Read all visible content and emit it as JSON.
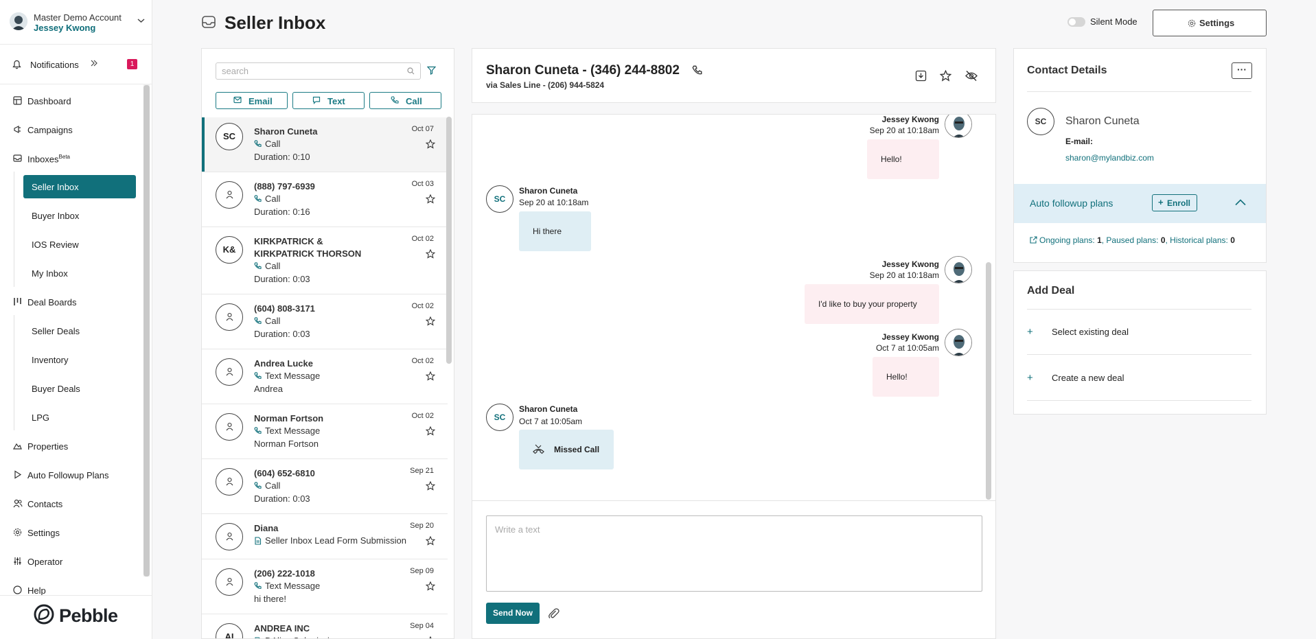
{
  "account": {
    "line1": "Master Demo Account",
    "line2": "Jessey Kwong"
  },
  "notifications": {
    "label": "Notifications",
    "count": "1"
  },
  "nav": {
    "dashboard": "Dashboard",
    "campaigns": "Campaigns",
    "inboxes": "Inboxes",
    "inboxes_sup": "Beta",
    "seller_inbox": "Seller Inbox",
    "buyer_inbox": "Buyer Inbox",
    "ios_review": "IOS Review",
    "my_inbox": "My Inbox",
    "deal_boards": "Deal Boards",
    "seller_deals": "Seller Deals",
    "inventory": "Inventory",
    "buyer_deals": "Buyer Deals",
    "lpg": "LPG",
    "properties": "Properties",
    "auto_followup": "Auto Followup Plans",
    "contacts": "Contacts",
    "settings": "Settings",
    "operator": "Operator",
    "help": "Help"
  },
  "brand": {
    "logo_text": "Pebble"
  },
  "header": {
    "title": "Seller Inbox",
    "silent_mode": "Silent Mode",
    "silent_mode_on": false,
    "settings_label": "Settings"
  },
  "list": {
    "search_placeholder": "search",
    "buttons": {
      "email": "Email",
      "text": "Text",
      "call": "Call"
    },
    "conversations": [
      {
        "initials": "SC",
        "name": "Sharon Cuneta",
        "type": "Call",
        "sub": "Duration: 0:10",
        "date": "Oct 07"
      },
      {
        "initials": "",
        "name": "(888) 797-6939",
        "type": "Call",
        "sub": "Duration: 0:16",
        "date": "Oct 03"
      },
      {
        "initials": "K&",
        "name": "KIRKPATRICK & KIRKPATRICK THORSON",
        "type": "Call",
        "sub": "Duration: 0:03",
        "date": "Oct 02"
      },
      {
        "initials": "",
        "name": "(604) 808-3171",
        "type": "Call",
        "sub": "Duration: 0:03",
        "date": "Oct 02"
      },
      {
        "initials": "",
        "name": "Andrea Lucke",
        "type": "Text Message",
        "sub": "Andrea",
        "date": "Oct 02"
      },
      {
        "initials": "",
        "name": "Norman Fortson",
        "type": "Text Message",
        "sub": "Norman Fortson",
        "date": "Oct 02"
      },
      {
        "initials": "",
        "name": "(604) 652-6810",
        "type": "Call",
        "sub": "Duration: 0:03",
        "date": "Sep 21"
      },
      {
        "initials": "",
        "name": "Diana",
        "type": "Seller Inbox Lead Form Submission",
        "sub": "",
        "date": "Sep 20"
      },
      {
        "initials": "",
        "name": "(206) 222-1018",
        "type": "Text Message",
        "sub": "hi there!",
        "date": "Sep 09"
      },
      {
        "initials": "AI",
        "name": "ANDREA INC",
        "type": "DAlive Submission",
        "sub": "",
        "date": "Sep 04"
      }
    ]
  },
  "chat": {
    "title": "Sharon Cuneta - (346) 244-8802",
    "via": "via Sales Line - (206) 944-5824",
    "compose_placeholder": "Write a text",
    "send_label": "Send Now",
    "messages": [
      {
        "dir": "out",
        "name": "Jessey Kwong",
        "time": "Sep 20 at 10:18am",
        "text": "Hello!"
      },
      {
        "dir": "in",
        "initials": "SC",
        "name": "Sharon Cuneta",
        "time": "Sep 20 at 10:18am",
        "text": "Hi there"
      },
      {
        "dir": "out",
        "name": "Jessey Kwong",
        "time": "Sep 20 at 10:18am",
        "text": "I'd like to buy your property"
      },
      {
        "dir": "out",
        "name": "Jessey Kwong",
        "time": "Oct 7 at 10:05am",
        "text": "Hello!"
      },
      {
        "dir": "in",
        "initials": "SC",
        "name": "Sharon Cuneta",
        "time": "Oct 7 at 10:05am",
        "text": "Missed Call"
      }
    ]
  },
  "contact": {
    "header": "Contact Details",
    "more": "···",
    "initials": "SC",
    "name": "Sharon Cuneta",
    "email_label": "E-mail:",
    "email": "sharon@mylandbiz.com",
    "auto_label": "Auto followup plans",
    "enroll_label": "Enroll",
    "plans": {
      "ongoing_label": "Ongoing plans: ",
      "ongoing": "1",
      "paused_label": ", Paused plans: ",
      "paused": "0",
      "historical_label": ", Historical plans: ",
      "historical": "0"
    }
  },
  "deal": {
    "header": "Add Deal",
    "select_existing": "Select existing deal",
    "create_new": "Create a new deal"
  },
  "colors": {
    "accent": "#11707b",
    "badge": "#d9195b",
    "bubble_out": "#fdeef1",
    "bubble_in": "#dfeef4"
  }
}
